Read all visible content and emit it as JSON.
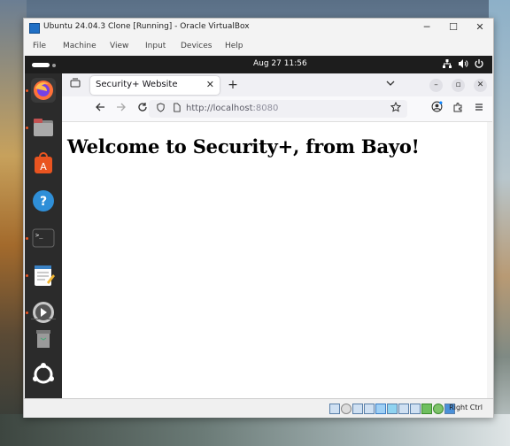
{
  "host": {
    "window_title": "Ubuntu 24.04.3 Clone [Running] - Oracle VirtualBox",
    "controls": {
      "minimize": "─",
      "maximize": "☐",
      "close": "✕"
    },
    "menu": [
      "File",
      "Machine",
      "View",
      "Input",
      "Devices",
      "Help"
    ],
    "status_bar": {
      "host_key": "Right Ctrl"
    }
  },
  "gnome": {
    "clock": "Aug 27  11:56",
    "tray": [
      "network-icon",
      "volume-icon",
      "power-icon"
    ]
  },
  "dock": {
    "apps": [
      {
        "name": "Firefox",
        "icon": "firefox-icon",
        "running": true
      },
      {
        "name": "Files",
        "icon": "files-icon",
        "running": true
      },
      {
        "name": "App Center",
        "icon": "app-center-icon",
        "running": false
      },
      {
        "name": "Help",
        "icon": "help-icon",
        "running": false
      },
      {
        "name": "Terminal",
        "icon": "terminal-icon",
        "running": true
      },
      {
        "name": "Text Editor",
        "icon": "text-editor-icon",
        "running": true
      },
      {
        "name": "Rhythmbox",
        "icon": "media-icon",
        "running": true
      },
      {
        "name": "Trash",
        "icon": "trash-icon",
        "running": false
      },
      {
        "name": "Show Apps",
        "icon": "ubuntu-apps-icon",
        "running": false
      }
    ]
  },
  "browser": {
    "tab_title": "Security+ Website",
    "tab_close": "✕",
    "new_tab": "+",
    "url_host": "http://localhost",
    "url_port": ":8080",
    "window_controls": {
      "minimize": "–",
      "maximize": "▫",
      "close": "✕"
    }
  },
  "page": {
    "heading": "Welcome to Security+, from Bayo!"
  }
}
